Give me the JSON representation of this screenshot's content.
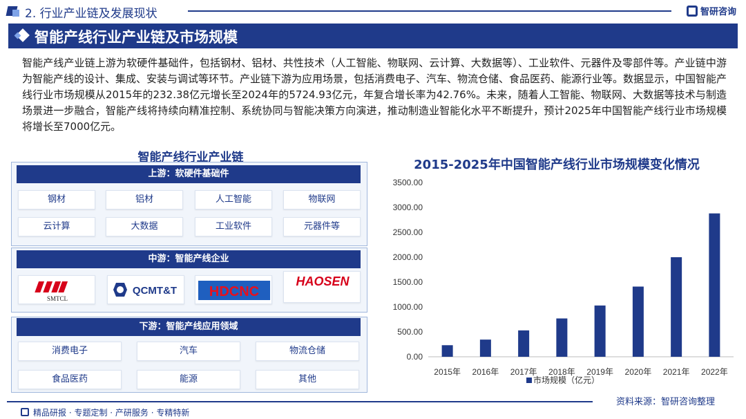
{
  "header": {
    "section_title": "2. 行业产业链及发展现状",
    "brand": "智研咨询"
  },
  "banner": {
    "title": "智能产线行业产业链及市场规模"
  },
  "intro": "智能产线产业链上游为软硬件基础件，包括钢材、铝材、共性技术（人工智能、物联网、云计算、大数据等）、工业软件、元器件及零部件等。产业链中游为智能产线的设计、集成、安装与调试等环节。产业链下游为应用场景，包括消费电子、汽车、物流仓储、食品医药、能源行业等。数据显示，中国智能产线行业市场规模从2015年的232.38亿元增长至2024年的5724.93亿元，年复合增长率为42.76%。未来，随着人工智能、物联网、大数据等技术与制造场景进一步融合，智能产线将持续向精准控制、系统协同与智能决策方向演进，推动制造业智能化水平不断提升，预计2025年中国智能产线行业市场规模将增长至7000亿元。",
  "chain": {
    "title": "智能产线行业产业链",
    "upstream": {
      "label": "上游：软硬件基础件",
      "items": [
        "钢材",
        "铝材",
        "人工智能",
        "物联网",
        "云计算",
        "大数据",
        "工业软件",
        "元器件等"
      ]
    },
    "midstream": {
      "label": "中游：智能产线企业",
      "logos": [
        "SMTCL",
        "QCMT&T",
        "HDCNC",
        "HAOSEN"
      ]
    },
    "downstream": {
      "label": "下游：智能产线应用领域",
      "items": [
        "消费电子",
        "汽车",
        "物流仓储",
        "食品医药",
        "能源",
        "其他"
      ]
    }
  },
  "source": "资料来源：智研咨询整理",
  "footer": "精品研报 · 专题定制 · 产研服务 · 专精特新",
  "colors": {
    "primary": "#1f3a8a",
    "accent": "#7ea3e8"
  },
  "chart_data": {
    "type": "bar",
    "title": "2015-2025年中国智能产线行业市场规模变化情况",
    "categories": [
      "2015年",
      "2016年",
      "2017年",
      "2018年",
      "2019年",
      "2020年",
      "2021年",
      "2022年"
    ],
    "series": [
      {
        "name": "市场规模（亿元）",
        "values": [
          232.38,
          345,
          530,
          770,
          1030,
          1410,
          2000,
          2880
        ]
      }
    ],
    "yticks": [
      "0.00",
      "500.00",
      "1000.00",
      "1500.00",
      "2000.00",
      "2500.00",
      "3000.00",
      "3500.00"
    ],
    "ylim": [
      0,
      3500
    ],
    "legend": "bottom",
    "grid": false
  }
}
